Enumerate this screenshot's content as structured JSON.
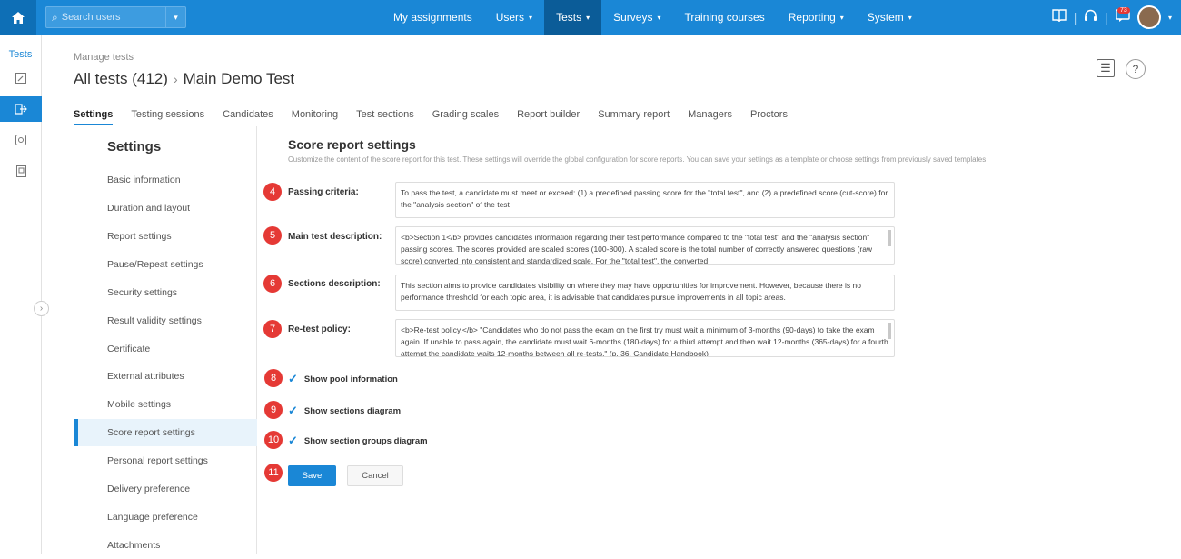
{
  "topbar": {
    "search_placeholder": "Search users",
    "nav": [
      {
        "label": "My assignments",
        "caret": ""
      },
      {
        "label": "Users",
        "caret": "▾"
      },
      {
        "label": "Tests",
        "caret": "▾"
      },
      {
        "label": "Surveys",
        "caret": "▾"
      },
      {
        "label": "Training courses",
        "caret": ""
      },
      {
        "label": "Reporting",
        "caret": "▾"
      },
      {
        "label": "System",
        "caret": "▾"
      }
    ],
    "active_nav_index": 2,
    "notification_count": "73",
    "brand_color": "#1a87d6"
  },
  "leftrail": {
    "label": "Tests"
  },
  "header": {
    "crumb_small": "Manage tests",
    "crumb_parent": "All tests (412)",
    "crumb_sep": "›",
    "crumb_current": "Main Demo Test",
    "help_label": "?"
  },
  "tabs": [
    "Settings",
    "Testing sessions",
    "Candidates",
    "Monitoring",
    "Test sections",
    "Grading scales",
    "Report builder",
    "Summary report",
    "Managers",
    "Proctors"
  ],
  "settings_nav": {
    "title": "Settings",
    "items": [
      "Basic information",
      "Duration and layout",
      "Report settings",
      "Pause/Repeat settings",
      "Security settings",
      "Result validity settings",
      "Certificate",
      "External attributes",
      "Mobile settings",
      "Score report settings",
      "Personal report settings",
      "Delivery preference",
      "Language preference",
      "Attachments"
    ],
    "active_index": 9
  },
  "main": {
    "title": "Score report settings",
    "subtitle": "Customize the content of the score report for this test. These settings will override the global configuration for score reports. You can save your settings as a template or choose settings from previously saved templates.",
    "fields": [
      {
        "num": "4",
        "label": "Passing criteria:",
        "value": "To pass the test, a candidate must meet or exceed: (1) a predefined passing score for the \"total test\", and (2) a predefined score (cut-score) for the \"analysis section\" of the test"
      },
      {
        "num": "5",
        "label": "Main test description:",
        "value": "<b>Section 1</b> provides candidates information regarding their test performance compared to the \"total test\" and the \"analysis section\" passing scores. The scores provided are scaled scores (100-800). A scaled score is the total number of correctly answered questions (raw score) converted into consistent and standardized scale. For the \"total test\", the converted"
      },
      {
        "num": "6",
        "label": "Sections description:",
        "value": "This section aims to provide candidates visibility on where they may have opportunities for improvement. However, because there is no performance threshold for each topic area, it is advisable that candidates pursue improvements in all topic areas."
      },
      {
        "num": "7",
        "label": "Re-test policy:",
        "value": "<b>Re-test policy.</b> \"Candidates who do not pass the exam on the first try must wait a minimum of 3-months (90-days) to take the exam again. If unable to pass again, the candidate must wait 6-months (180-days) for a third attempt and then wait 12-months (365-days) for a fourth attempt the candidate waits 12-months between all re-tests.\" (p. 36, Candidate Handbook)"
      }
    ],
    "checks": [
      {
        "num": "8",
        "label": "Show pool information"
      },
      {
        "num": "9",
        "label": "Show sections diagram"
      },
      {
        "num": "10",
        "label": "Show section groups diagram"
      }
    ],
    "save_num": "11",
    "save_label": "Save",
    "cancel_label": "Cancel"
  }
}
